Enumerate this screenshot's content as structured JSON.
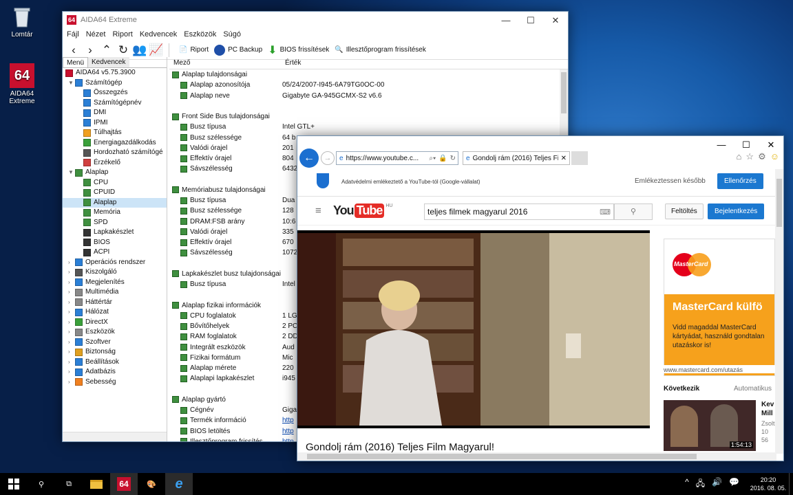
{
  "desktop": {
    "icons": [
      {
        "label": "Lomtár",
        "icon": "recycle-bin-icon"
      },
      {
        "label": "AIDA64\nExtreme",
        "icon": "aida64-icon"
      }
    ]
  },
  "aida": {
    "title": "AIDA64 Extreme",
    "menu": [
      "Fájl",
      "Nézet",
      "Riport",
      "Kedvencek",
      "Eszközök",
      "Súgó"
    ],
    "toolbar": {
      "riport": "Riport",
      "pcbackup": "PC Backup",
      "bios": "BIOS frissítések",
      "driver": "Illesztőprogram frissítések"
    },
    "tabs": [
      "Menü",
      "Kedvencek"
    ],
    "tree": [
      {
        "label": "AIDA64 v5.75.3900",
        "lvl": 0,
        "tog": "",
        "c": "#c8102e"
      },
      {
        "label": "Számítógép",
        "lvl": 1,
        "tog": "▼",
        "c": "#2b7fd6"
      },
      {
        "label": "Összegzés",
        "lvl": 2,
        "tog": "",
        "c": "#2b7fd6"
      },
      {
        "label": "Számítógépnév",
        "lvl": 2,
        "tog": "",
        "c": "#2b7fd6"
      },
      {
        "label": "DMI",
        "lvl": 2,
        "tog": "",
        "c": "#2b7fd6"
      },
      {
        "label": "IPMI",
        "lvl": 2,
        "tog": "",
        "c": "#2b7fd6"
      },
      {
        "label": "Túlhajtás",
        "lvl": 2,
        "tog": "",
        "c": "#f0a020"
      },
      {
        "label": "Energiagazdálkodás",
        "lvl": 2,
        "tog": "",
        "c": "#3aa03a"
      },
      {
        "label": "Hordozható számítógé",
        "lvl": 2,
        "tog": "",
        "c": "#555"
      },
      {
        "label": "Érzékelő",
        "lvl": 2,
        "tog": "",
        "c": "#d04040"
      },
      {
        "label": "Alaplap",
        "lvl": 1,
        "tog": "▼",
        "c": "#3f8f3f"
      },
      {
        "label": "CPU",
        "lvl": 2,
        "tog": "",
        "c": "#3f8f3f"
      },
      {
        "label": "CPUID",
        "lvl": 2,
        "tog": "",
        "c": "#3f8f3f"
      },
      {
        "label": "Alaplap",
        "lvl": 2,
        "tog": "",
        "c": "#3f8f3f",
        "sel": true
      },
      {
        "label": "Memória",
        "lvl": 2,
        "tog": "",
        "c": "#3f8f3f"
      },
      {
        "label": "SPD",
        "lvl": 2,
        "tog": "",
        "c": "#3f8f3f"
      },
      {
        "label": "Lapkakészlet",
        "lvl": 2,
        "tog": "",
        "c": "#333"
      },
      {
        "label": "BIOS",
        "lvl": 2,
        "tog": "",
        "c": "#333"
      },
      {
        "label": "ACPI",
        "lvl": 2,
        "tog": "",
        "c": "#333"
      },
      {
        "label": "Operációs rendszer",
        "lvl": 1,
        "tog": "›",
        "c": "#2b7fd6"
      },
      {
        "label": "Kiszolgáló",
        "lvl": 1,
        "tog": "›",
        "c": "#555"
      },
      {
        "label": "Megjelenítés",
        "lvl": 1,
        "tog": "›",
        "c": "#2b7fd6"
      },
      {
        "label": "Multimédia",
        "lvl": 1,
        "tog": "›",
        "c": "#888"
      },
      {
        "label": "Háttértár",
        "lvl": 1,
        "tog": "›",
        "c": "#888"
      },
      {
        "label": "Hálózat",
        "lvl": 1,
        "tog": "›",
        "c": "#2b7fd6"
      },
      {
        "label": "DirectX",
        "lvl": 1,
        "tog": "›",
        "c": "#3aa03a"
      },
      {
        "label": "Eszközök",
        "lvl": 1,
        "tog": "›",
        "c": "#888"
      },
      {
        "label": "Szoftver",
        "lvl": 1,
        "tog": "›",
        "c": "#2b7fd6"
      },
      {
        "label": "Biztonság",
        "lvl": 1,
        "tog": "›",
        "c": "#e0a020"
      },
      {
        "label": "Beállítások",
        "lvl": 1,
        "tog": "›",
        "c": "#2b7fd6"
      },
      {
        "label": "Adatbázis",
        "lvl": 1,
        "tog": "›",
        "c": "#2b7fd6"
      },
      {
        "label": "Sebesség",
        "lvl": 1,
        "tog": "›",
        "c": "#f08020"
      }
    ],
    "columns": {
      "field": "Mező",
      "value": "Érték"
    },
    "rows": [
      {
        "t": "g",
        "m": "Alaplap tulajdonságai"
      },
      {
        "t": "i",
        "m": "Alaplap azonosítója",
        "v": "05/24/2007-I945-6A79TG0OC-00"
      },
      {
        "t": "i",
        "m": "Alaplap neve",
        "v": "Gigabyte GA-945GCMX-S2 v6.6"
      },
      {
        "t": "b"
      },
      {
        "t": "g",
        "m": "Front Side Bus tulajdonságai"
      },
      {
        "t": "i",
        "m": "Busz típusa",
        "v": "Intel GTL+"
      },
      {
        "t": "i",
        "m": "Busz szélessége",
        "v": "64 b"
      },
      {
        "t": "i",
        "m": "Valódi órajel",
        "v": "201"
      },
      {
        "t": "i",
        "m": "Effektív órajel",
        "v": "804"
      },
      {
        "t": "i",
        "m": "Sávszélesség",
        "v": "6432"
      },
      {
        "t": "b"
      },
      {
        "t": "g",
        "m": "Memóriabusz tulajdonságai"
      },
      {
        "t": "i",
        "m": "Busz típusa",
        "v": "Dua"
      },
      {
        "t": "i",
        "m": "Busz szélessége",
        "v": "128"
      },
      {
        "t": "i",
        "m": "DRAM:FSB arány",
        "v": "10:6"
      },
      {
        "t": "i",
        "m": "Valódi órajel",
        "v": "335"
      },
      {
        "t": "i",
        "m": "Effektív órajel",
        "v": "670"
      },
      {
        "t": "i",
        "m": "Sávszélesség",
        "v": "1072"
      },
      {
        "t": "b"
      },
      {
        "t": "g",
        "m": "Lapkakészlet busz tulajdonságai"
      },
      {
        "t": "i",
        "m": "Busz típusa",
        "v": "Intel"
      },
      {
        "t": "b"
      },
      {
        "t": "g",
        "m": "Alaplap fizikai információk"
      },
      {
        "t": "i",
        "m": "CPU foglalatok",
        "v": "1 LG"
      },
      {
        "t": "i",
        "m": "Bővítőhelyek",
        "v": "2 PC"
      },
      {
        "t": "i",
        "m": "RAM foglalatok",
        "v": "2 DD"
      },
      {
        "t": "i",
        "m": "Integrált eszközök",
        "v": "Aud"
      },
      {
        "t": "i",
        "m": "Fizikai formátum",
        "v": "Mic"
      },
      {
        "t": "i",
        "m": "Alaplap mérete",
        "v": "220"
      },
      {
        "t": "i",
        "m": "Alaplapi lapkakészlet",
        "v": "i945"
      },
      {
        "t": "b"
      },
      {
        "t": "g",
        "m": "Alaplap gyártó"
      },
      {
        "t": "i",
        "m": "Cégnév",
        "v": "Giga"
      },
      {
        "t": "i",
        "m": "Termék információ",
        "v": "http"
      },
      {
        "t": "i",
        "m": "BIOS letöltés",
        "v": "http"
      },
      {
        "t": "i",
        "m": "Illesztőprogram frissítés",
        "v": "http"
      }
    ]
  },
  "ie": {
    "url": "https://www.youtube.c...",
    "tab_title": "Gondolj rám (2016) Teljes Fi...",
    "privacy": "Adatvédelmi emlékeztető a YouTube-tól (Google-vállalat)",
    "remind_later": "Emlékeztessen később",
    "check": "Ellenőrzés",
    "search_value": "teljes filmek magyarul 2016",
    "upload": "Feltöltés",
    "signin": "Bejelentkezés",
    "logo_you": "You",
    "logo_tube": "Tube",
    "logo_hu": "HU",
    "ad_brand": "MasterCard",
    "ad_headline": "MasterCard külfö",
    "ad_body": "Vidd magaddal MasterCard kártyádat, használd gondtalan utazáskor is!",
    "ad_url": "www.mastercard.com/utazás",
    "next": "Következik",
    "autoplay": "Automatikus",
    "thumb_time": "1:54:13",
    "side_title": "Kev Mill",
    "side_meta": "Zsolt 10 56",
    "video_title": "Gondolj rám (2016) Teljes Film Magyarul!"
  },
  "taskbar": {
    "time": "20:20",
    "date": "2016. 08. 05."
  }
}
